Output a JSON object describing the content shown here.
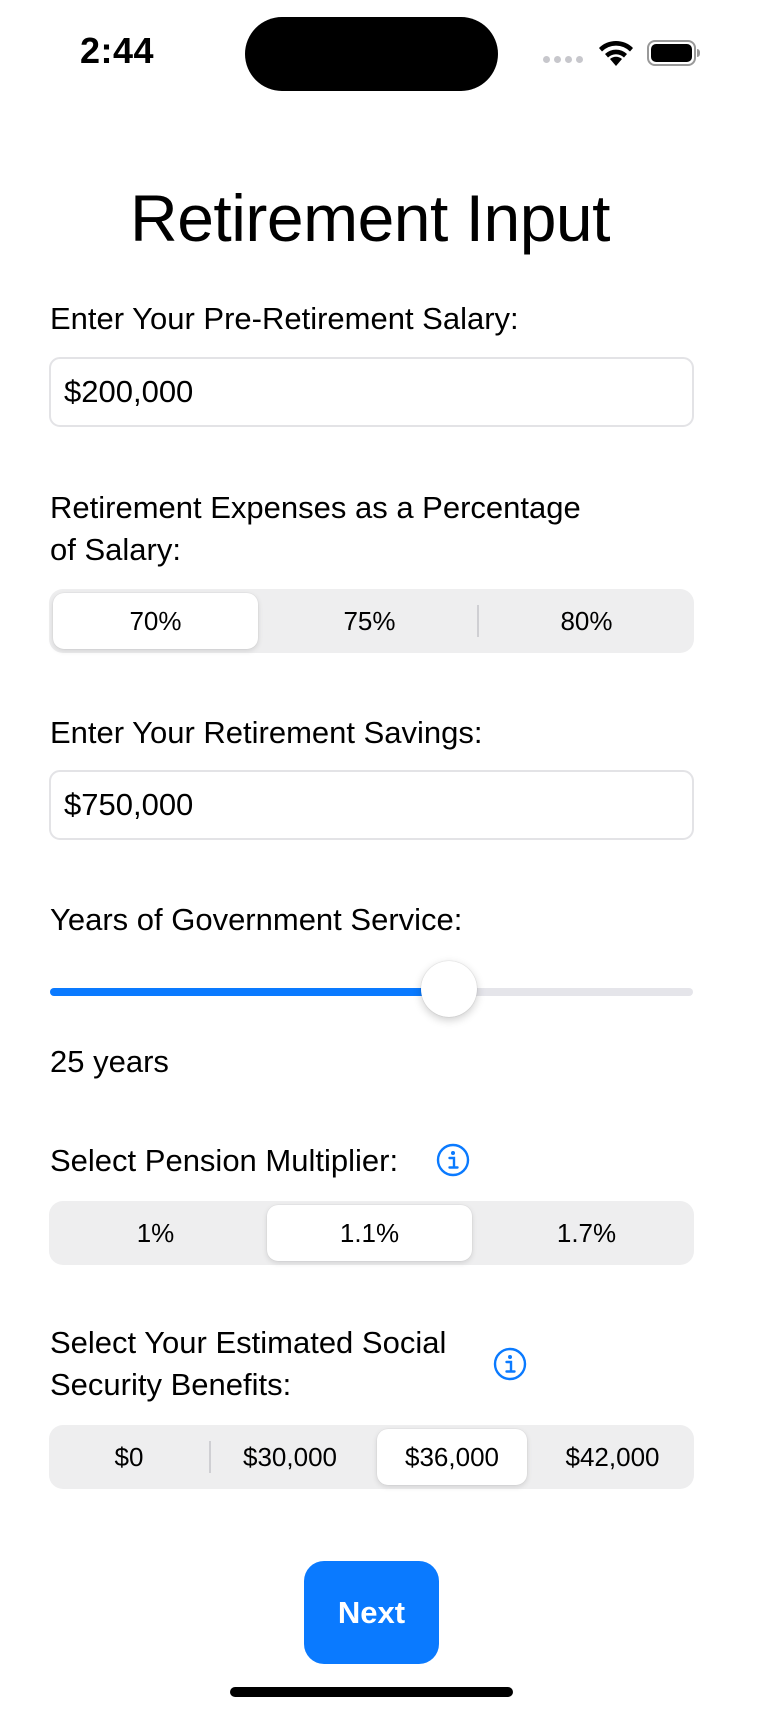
{
  "status_bar": {
    "time": "2:44",
    "icons": [
      "cellular-signal-icon",
      "wifi-icon",
      "battery-icon"
    ]
  },
  "page": {
    "title": "Retirement Input"
  },
  "salary": {
    "label": "Enter Your Pre-Retirement Salary:",
    "value": "$200,000"
  },
  "expenses": {
    "label_line1": "Retirement Expenses as a Percentage",
    "label_line2": "of Salary:",
    "options": [
      "70%",
      "75%",
      "80%"
    ],
    "selected": "70%"
  },
  "savings": {
    "label": "Enter Your Retirement Savings:",
    "value": "$750,000"
  },
  "service": {
    "label": "Years of Government Service:",
    "slider_fraction": 0.62,
    "value_text": "25 years"
  },
  "pension": {
    "label": "Select Pension Multiplier:",
    "info_icon": "info-icon",
    "options": [
      "1%",
      "1.1%",
      "1.7%"
    ],
    "selected": "1.1%"
  },
  "social_security": {
    "label_line1": "Select Your Estimated Social",
    "label_line2": "Security Benefits:",
    "info_icon": "info-icon",
    "options": [
      "$0",
      "$30,000",
      "$36,000",
      "$42,000"
    ],
    "selected": "$36,000"
  },
  "actions": {
    "next_label": "Next"
  },
  "colors": {
    "accent": "#0a7aff",
    "segment_bg": "#eeeeef",
    "track": "#e5e5ea"
  }
}
